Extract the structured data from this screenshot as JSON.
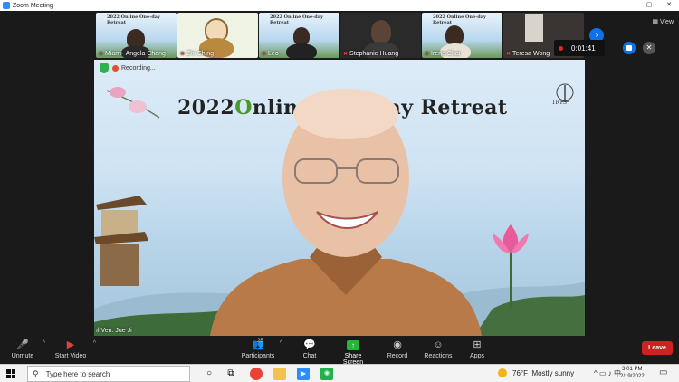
{
  "window": {
    "title": "Zoom Meeting",
    "controls": [
      "—",
      "▢",
      "✕"
    ]
  },
  "gallery": {
    "thumbnails": [
      {
        "name": "Miami- Angela Chang",
        "mini_title": "2022 Online One-day Retreat"
      },
      {
        "name": "Zhi Ching"
      },
      {
        "name": "Leo",
        "mini_title": "2022 Online One-day Retreat"
      },
      {
        "name": "Stephanie Huang"
      },
      {
        "name": "Irene Chai",
        "mini_title": "2022 Online One-day Retreat"
      },
      {
        "name": "Teresa Wong"
      }
    ],
    "view_label": "View",
    "next_icon": "chevron-right-icon"
  },
  "recording_pill": {
    "time": "0:01:41"
  },
  "main_video": {
    "banner_year": "2022",
    "banner_o": "O",
    "banner_rest": "nline One-day Retreat",
    "recording_label": "Recording...",
    "speaker_name": "Ven. Jue Ji",
    "emblem_text": "TRTS"
  },
  "toolbar": {
    "unmute": "Unmute",
    "start_video": "Start Video",
    "participants": "Participants",
    "participants_count": "25",
    "chat": "Chat",
    "share_screen": "Share Screen",
    "record": "Record",
    "reactions": "Reactions",
    "apps": "Apps",
    "leave": "Leave"
  },
  "taskbar": {
    "search_placeholder": "Type here to search",
    "weather_temp": "76°F",
    "weather_desc": "Mostly sunny",
    "ime": "中",
    "time": "3:01 PM",
    "date": "2/19/2022"
  }
}
